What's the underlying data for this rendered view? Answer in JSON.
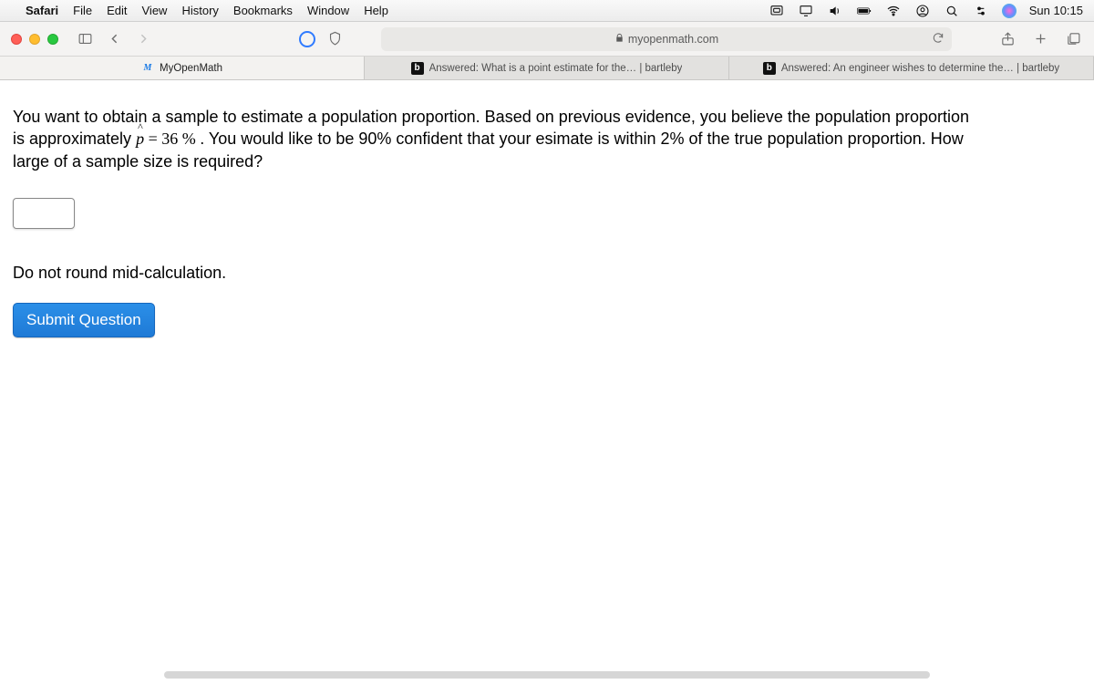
{
  "menubar": {
    "app": "Safari",
    "items": [
      "File",
      "Edit",
      "View",
      "History",
      "Bookmarks",
      "Window",
      "Help"
    ],
    "clock": "Sun 10:15"
  },
  "toolbar": {
    "url_host": "myopenmath.com"
  },
  "tabs": [
    {
      "label": "MyOpenMath",
      "fav": "M",
      "active": true
    },
    {
      "label": "Answered: What is a point estimate for the… | bartleby",
      "fav": "b",
      "active": false
    },
    {
      "label": "Answered: An engineer wishes to determine the… | bartleby",
      "fav": "b",
      "active": false
    }
  ],
  "question": {
    "pre": "You want to obtain a sample to estimate a population proportion. Based on previous evidence, you believe the population proportion is approximately ",
    "phat": "p",
    "eq": " = ",
    "pct": "36 % ",
    "post": ". You would like to be 90% confident that your esimate is within 2% of the true population proportion. How large of a sample size is required?"
  },
  "note": "Do not round mid-calculation.",
  "submit_label": "Submit Question"
}
